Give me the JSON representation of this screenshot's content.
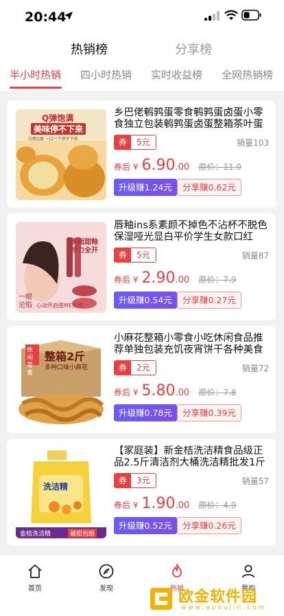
{
  "status": {
    "time": "20:44"
  },
  "top_tabs": [
    "热销榜",
    "分享榜"
  ],
  "sub_tabs": [
    "半小时热销",
    "四小时热销",
    "实时收益榜",
    "全网热销榜"
  ],
  "products": [
    {
      "title": "乡巴佬鹌鹑蛋零食鹌鹑蛋卤蛋小零食独立包装鹌鹑蛋卤蛋整箱茶叶蛋",
      "coupon_tag": "券",
      "coupon_amount": "5元",
      "sales": "销量103",
      "after_label": "券后 ¥",
      "price_int": "6.90",
      "price_dec": ".00",
      "orig_price": "原价：11.9",
      "upgrade_btn": "升级赚1.24元",
      "share_btn": "分享赚0.62元",
      "img_text1": "Q弹饱满",
      "img_text2": "美味停不下来",
      "img_text3": "口感Q弹 一口一个停不下来"
    },
    {
      "title": "唇釉ins系素颜不掉色不沾杯不脱色保湿哑光显白平价学生女款口红",
      "coupon_tag": "券",
      "coupon_amount": "5元",
      "sales": "销量87",
      "after_label": "券后 ¥",
      "price_int": "2.90",
      "price_dec": ".00",
      "orig_price": "原价：7.9",
      "upgrade_btn": "升级赚0.54元",
      "share_btn": "分享赚0.27元",
      "img_text1": "多面甜釉",
      "img_text2": "粉力全开",
      "img_text3": "一眼沦陷",
      "img_text4": "心动开启甜ME釉惑"
    },
    {
      "title": "小麻花整箱小零食小吃休闲食品推荐单独包装充饥夜宵饼干各种美食",
      "coupon_tag": "券",
      "coupon_amount": "2元",
      "sales": "销量72",
      "after_label": "券后 ¥",
      "price_int": "5.80",
      "price_dec": ".00",
      "orig_price": "原价：7.8",
      "upgrade_btn": "升级赚0.78元",
      "share_btn": "分享赚0.39元",
      "img_text1": "整箱2斤",
      "img_text2": "多种口味小麻花",
      "img_text3": "休闲零食"
    },
    {
      "title": "【家庭装】新金桔洗洁精食品级正品2.5斤清洁剂大桶洗洁精批发1斤",
      "coupon_tag": "券",
      "coupon_amount": "3元",
      "sales": "销量57",
      "after_label": "券后 ¥",
      "price_int": "1.90",
      "price_dec": ".00",
      "orig_price": "原价：4.9",
      "upgrade_btn": "升级赚0.52元",
      "share_btn": "分享赚0.26元",
      "img_text1": "洗洁精",
      "img_text2": "金桔洗洁精",
      "img_text3": "破损包赔"
    }
  ],
  "bottom_nav": [
    "首页",
    "发现",
    "热销",
    "我的"
  ],
  "watermark": {
    "text": "欧金软件园",
    "url": "www.apoujin.com"
  },
  "colors": {
    "accent": "#e8403e",
    "upgrade": "#6a5cf5",
    "watermark": "#f2b200"
  }
}
